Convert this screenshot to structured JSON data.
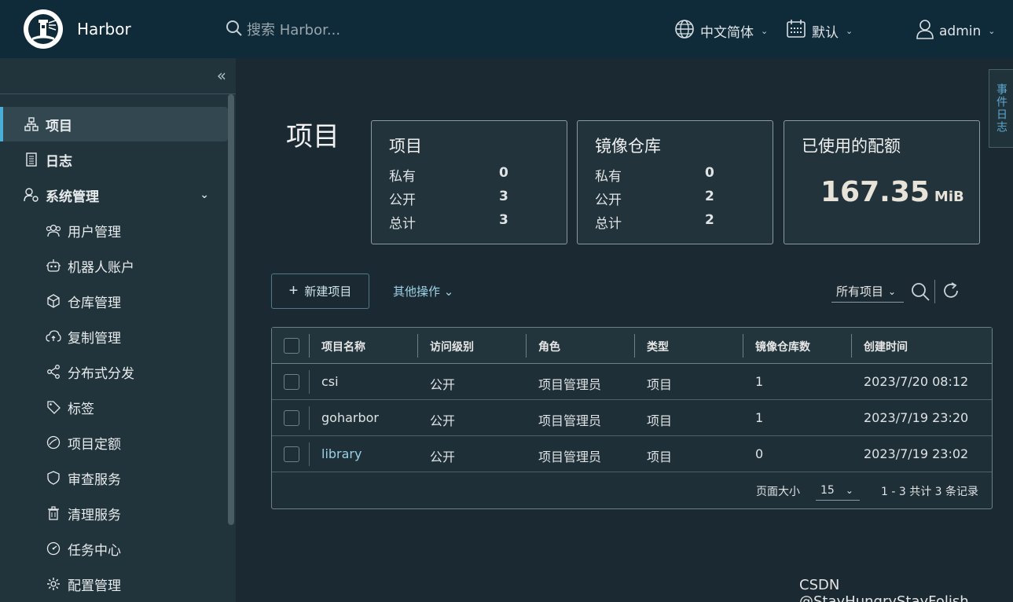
{
  "header": {
    "app_name": "Harbor",
    "search_placeholder": "搜索 Harbor...",
    "language": "中文简体",
    "datetime_format": "默认",
    "user": "admin"
  },
  "sidebar": {
    "items": [
      {
        "label": "项目",
        "active": true,
        "level": "top"
      },
      {
        "label": "日志",
        "level": "top"
      },
      {
        "label": "系统管理",
        "level": "top"
      },
      {
        "label": "用户管理",
        "level": "sub"
      },
      {
        "label": "机器人账户",
        "level": "sub"
      },
      {
        "label": "仓库管理",
        "level": "sub"
      },
      {
        "label": "复制管理",
        "level": "sub"
      },
      {
        "label": "分布式分发",
        "level": "sub"
      },
      {
        "label": "标签",
        "level": "sub"
      },
      {
        "label": "项目定额",
        "level": "sub"
      },
      {
        "label": "审查服务",
        "level": "sub"
      },
      {
        "label": "清理服务",
        "level": "sub"
      },
      {
        "label": "任务中心",
        "level": "sub"
      },
      {
        "label": "配置管理",
        "level": "sub"
      }
    ]
  },
  "main": {
    "title": "项目",
    "cards": {
      "projects": {
        "title": "项目",
        "private_label": "私有",
        "private": "0",
        "public_label": "公开",
        "public": "3",
        "total_label": "总计",
        "total": "3"
      },
      "repos": {
        "title": "镜像仓库",
        "private_label": "私有",
        "private": "0",
        "public_label": "公开",
        "public": "2",
        "total_label": "总计",
        "total": "2"
      },
      "quota": {
        "title": "已使用的配额",
        "value": "167.35",
        "unit": "MiB"
      }
    },
    "toolbar": {
      "new_project": "新建项目",
      "other_actions": "其他操作",
      "filter": "所有项目"
    },
    "table": {
      "columns": [
        "项目名称",
        "访问级别",
        "角色",
        "类型",
        "镜像仓库数",
        "创建时间"
      ],
      "rows": [
        {
          "name": "csi",
          "access": "公开",
          "role": "项目管理员",
          "type": "项目",
          "repos": "1",
          "created": "2023/7/20 08:12"
        },
        {
          "name": "goharbor",
          "access": "公开",
          "role": "项目管理员",
          "type": "项目",
          "repos": "1",
          "created": "2023/7/19 23:20"
        },
        {
          "name": "library",
          "access": "公开",
          "role": "项目管理员",
          "type": "项目",
          "repos": "0",
          "created": "2023/7/19 23:02"
        }
      ],
      "page_size_label": "页面大小",
      "page_size": "15",
      "summary": "1 - 3 共计 3 条记录"
    },
    "side_tab": "事件日志"
  },
  "watermark": "CSDN @StayHungryStayFolish"
}
